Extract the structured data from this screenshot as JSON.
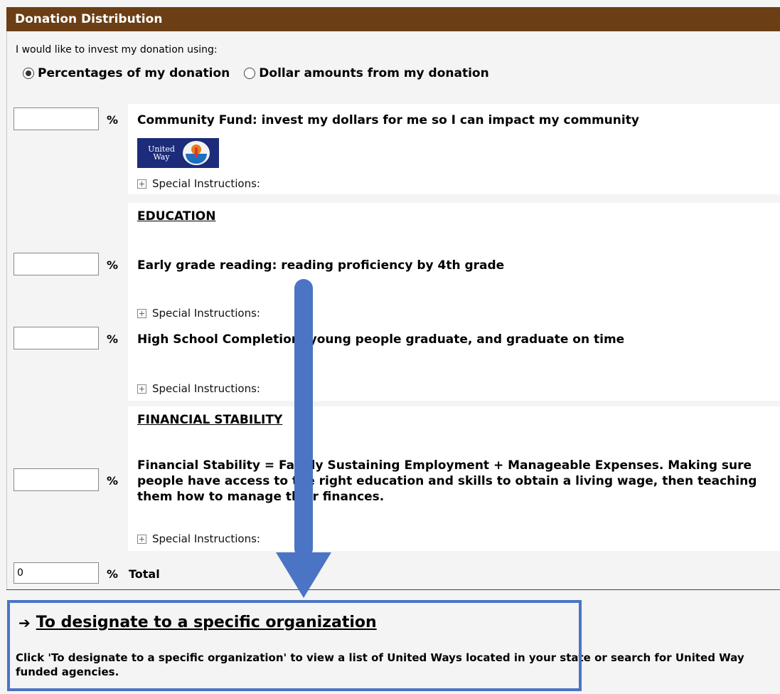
{
  "header": {
    "title": "Donation Distribution"
  },
  "intro": {
    "text": "I would like to invest my donation using:"
  },
  "options": [
    {
      "label": "Percentages of my donation",
      "selected": true
    },
    {
      "label": "Dollar amounts from my donation",
      "selected": false
    }
  ],
  "percent_sign": "%",
  "community_fund": {
    "title": "Community Fund: invest my dollars for me so I can impact my community",
    "logo": {
      "line1": "United",
      "line2": "Way"
    },
    "special_label": "Special Instructions:",
    "value": ""
  },
  "categories": [
    {
      "heading": "EDUCATION",
      "items": [
        {
          "title": "Early grade reading: reading proficiency by 4th grade",
          "special_label": "Special Instructions:",
          "value": ""
        },
        {
          "title": "High School Completion: young people graduate, and graduate on time",
          "special_label": "Special Instructions:",
          "value": ""
        }
      ]
    },
    {
      "heading": "FINANCIAL STABILITY",
      "items": [
        {
          "title": "Financial Stability = Family Sustaining Employment + Manageable Expenses. Making sure people have access to the right education and skills to obtain a living wage, then teaching them how to manage their finances.",
          "special_label": "Special Instructions:",
          "value": ""
        }
      ]
    }
  ],
  "total": {
    "label": "Total",
    "value": "0"
  },
  "designate": {
    "link_text": "To designate to a specific organization",
    "arrow_glyph": "➔",
    "description": "Click 'To designate to a specific organization' to view a list of United Ways located in your state or search for United Way funded agencies."
  },
  "colors": {
    "header_bg": "#6b3e15",
    "annotation_blue": "#4b74c4",
    "logo_bg": "#1c2c7a"
  }
}
